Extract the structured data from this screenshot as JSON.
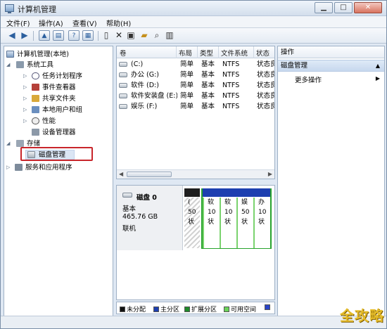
{
  "window": {
    "title": "计算机管理"
  },
  "menu": [
    "文件(F)",
    "操作(A)",
    "查看(V)",
    "帮助(H)"
  ],
  "toolbar_icons": [
    "back-arrow-icon",
    "forward-arrow-icon",
    "up-folder-icon",
    "console-tree-icon",
    "help-icon",
    "properties-icon",
    "new-doc-icon",
    "delete-icon",
    "folder-open-icon",
    "search-icon",
    "refresh-icon"
  ],
  "tree": {
    "root": "计算机管理(本地)",
    "system_tools": "系统工具",
    "task_scheduler": "任务计划程序",
    "event_viewer": "事件查看器",
    "shared_folders": "共享文件夹",
    "local_users": "本地用户和组",
    "performance": "性能",
    "device_manager": "设备管理器",
    "storage": "存储",
    "disk_management": "磁盘管理",
    "services": "服务和应用程序"
  },
  "volumes": {
    "headers": [
      "卷",
      "布局",
      "类型",
      "文件系统",
      "状态"
    ],
    "rows": [
      [
        "(C:)",
        "简单",
        "基本",
        "NTFS",
        "状态良"
      ],
      [
        "办公 (G:)",
        "简单",
        "基本",
        "NTFS",
        "状态良"
      ],
      [
        "软件 (D:)",
        "简单",
        "基本",
        "NTFS",
        "状态良"
      ],
      [
        "软件安装盘 (E:)",
        "简单",
        "基本",
        "NTFS",
        "状态良"
      ],
      [
        "娱乐 (F:)",
        "简单",
        "基本",
        "NTFS",
        "状态良"
      ]
    ]
  },
  "disk": {
    "name": "磁盘 0",
    "type": "基本",
    "size": "465.76 GB",
    "status": "联机",
    "partitions": [
      [
        "(",
        "50",
        "状"
      ],
      [
        "软",
        "10",
        "状"
      ],
      [
        "软",
        "10",
        "状"
      ],
      [
        "娱",
        "50",
        "状"
      ],
      [
        "办",
        "10",
        "状"
      ]
    ]
  },
  "legend": [
    "未分配",
    "主分区",
    "扩展分区",
    "可用空间"
  ],
  "legend_colors": [
    "#111111",
    "#1d3fb0",
    "#1f8a2a",
    "#6ad35a",
    "#2a44c8"
  ],
  "actions": {
    "header": "操作",
    "selected": "磁盘管理",
    "more": "更多操作"
  },
  "watermark": "全攻略"
}
